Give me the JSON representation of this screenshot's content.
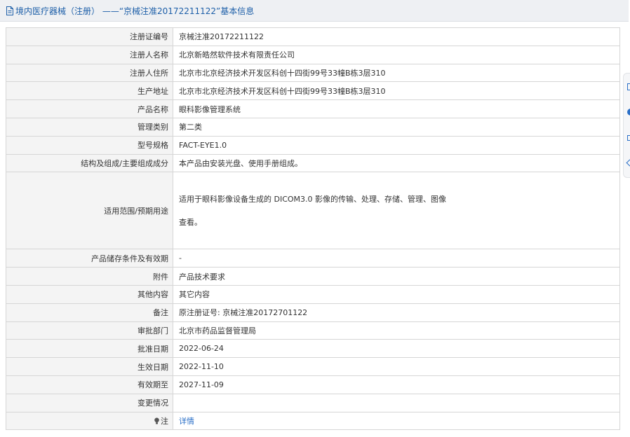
{
  "header": {
    "title": "境内医疗器械（注册） ——“京械注准20172211122”基本信息"
  },
  "rows": [
    {
      "label": "注册证编号",
      "value": "京械注准20172211122"
    },
    {
      "label": "注册人名称",
      "value": "北京新皓然软件技术有限责任公司"
    },
    {
      "label": "注册人住所",
      "value": "北京市北京经济技术开发区科创十四街99号33幢B栋3层310"
    },
    {
      "label": "生产地址",
      "value": "北京市北京经济技术开发区科创十四街99号33幢B栋3层310"
    },
    {
      "label": "产品名称",
      "value": "眼科影像管理系统"
    },
    {
      "label": "管理类别",
      "value": "第二类"
    },
    {
      "label": "型号规格",
      "value": "FACT-EYE1.0"
    },
    {
      "label": "结构及组成/主要组成成分",
      "value": "本产品由安装光盘、使用手册组成。"
    },
    {
      "label": "适用范围/预期用途",
      "value_line1": "适用于眼科影像设备生成的 DICOM3.0 影像的传输、处理、存储、管理、图像",
      "value_line2": "查看。"
    },
    {
      "label": "产品储存条件及有效期",
      "value": "-"
    },
    {
      "label": "附件",
      "value": "产品技术要求"
    },
    {
      "label": "其他内容",
      "value": "其它内容"
    },
    {
      "label": "备注",
      "value": "原注册证号: 京械注准20172701122"
    },
    {
      "label": "审批部门",
      "value": "北京市药品监督管理局"
    },
    {
      "label": "批准日期",
      "value": "2022-06-24"
    },
    {
      "label": "生效日期",
      "value": "2022-11-10"
    },
    {
      "label": "有效期至",
      "value": "2027-11-09"
    },
    {
      "label": "变更情况",
      "value": ""
    },
    {
      "label": "注",
      "value": "详情"
    }
  ],
  "icons": {
    "header": "document-icon",
    "note": "lightbulb-icon"
  },
  "colors": {
    "link": "#2a6fc7",
    "header_bg": "#eef0f3",
    "label_bg": "#f4f4f4"
  }
}
